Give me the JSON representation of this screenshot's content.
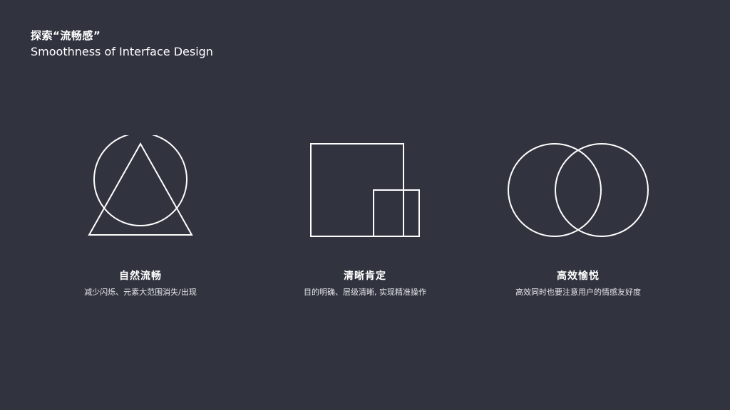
{
  "header": {
    "title_cn": "探索“流畅感”",
    "title_en": "Smoothness of Interface Design"
  },
  "concepts": [
    {
      "icon": "circle-triangle-icon",
      "title": "自然流畅",
      "description": "减少闪烁、元素大范围消失/出现"
    },
    {
      "icon": "nested-squares-icon",
      "title": "清晰肯定",
      "description": "目的明确、层级清晰, 实现精准操作"
    },
    {
      "icon": "overlapping-circles-icon",
      "title": "高效愉悦",
      "description": "高效同时也要注意用户的情感友好度"
    }
  ],
  "colors": {
    "background": "#31343f",
    "foreground": "#ffffff"
  }
}
